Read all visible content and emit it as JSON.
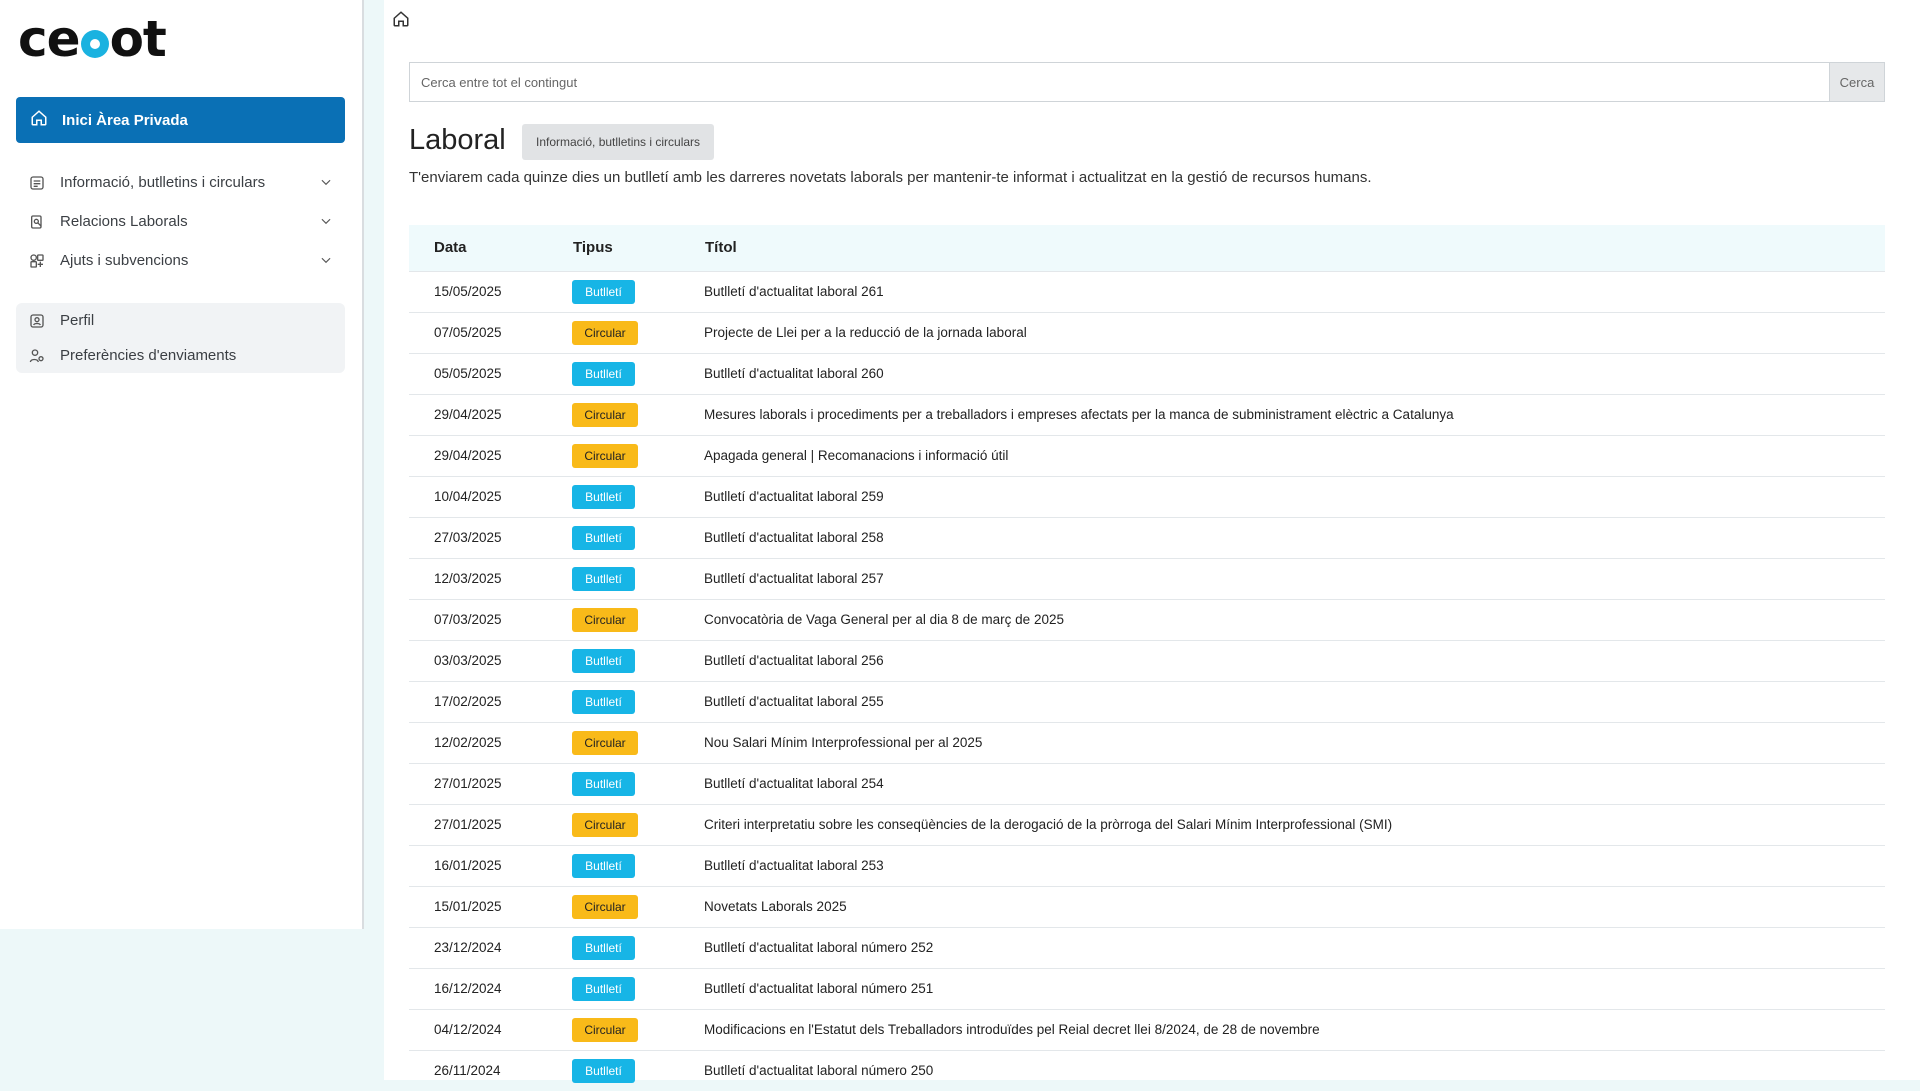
{
  "sidebar": {
    "logo": {
      "pre": "ce",
      "post": "ot"
    },
    "home_button": "Inici Àrea Privada",
    "nav_items": [
      {
        "label": "Informació, butlletins i circulars",
        "icon": "newsletter-icon"
      },
      {
        "label": "Relacions Laborals",
        "icon": "labor-icon"
      },
      {
        "label": "Ajuts i subvencions",
        "icon": "grants-icon"
      }
    ],
    "profile_items": [
      {
        "label": "Perfil",
        "icon": "profile-icon"
      },
      {
        "label": "Preferències d'enviaments",
        "icon": "user-settings-icon"
      }
    ]
  },
  "search": {
    "placeholder": "Cerca entre tot el contingut",
    "button": "Cerca"
  },
  "page": {
    "title": "Laboral",
    "tag": "Informació, butlletins i circulars",
    "description": "T'enviarem cada quinze dies un butlletí amb les darreres novetats laborals per mantenir-te informat i actualitzat en la gestió de recursos humans."
  },
  "table": {
    "headers": [
      "Data",
      "Tipus",
      "Títol"
    ],
    "rows": [
      {
        "date": "15/05/2025",
        "type": "Butlletí",
        "title": "Butlletí d'actualitat laboral 261"
      },
      {
        "date": "07/05/2025",
        "type": "Circular",
        "title": "Projecte de Llei per a la reducció de la jornada laboral"
      },
      {
        "date": "05/05/2025",
        "type": "Butlletí",
        "title": "Butlletí d'actualitat laboral 260"
      },
      {
        "date": "29/04/2025",
        "type": "Circular",
        "title": "Mesures laborals i procediments per a treballadors i empreses afectats per la manca de subministrament elèctric a Catalunya"
      },
      {
        "date": "29/04/2025",
        "type": "Circular",
        "title": "Apagada general | Recomanacions i informació útil"
      },
      {
        "date": "10/04/2025",
        "type": "Butlletí",
        "title": "Butlletí d'actualitat laboral 259"
      },
      {
        "date": "27/03/2025",
        "type": "Butlletí",
        "title": "Butlletí d'actualitat laboral 258"
      },
      {
        "date": "12/03/2025",
        "type": "Butlletí",
        "title": "Butlletí d'actualitat laboral 257"
      },
      {
        "date": "07/03/2025",
        "type": "Circular",
        "title": "Convocatòria de Vaga General per al dia 8 de març de 2025"
      },
      {
        "date": "03/03/2025",
        "type": "Butlletí",
        "title": "Butlletí d'actualitat laboral 256"
      },
      {
        "date": "17/02/2025",
        "type": "Butlletí",
        "title": "Butlletí d'actualitat laboral 255"
      },
      {
        "date": "12/02/2025",
        "type": "Circular",
        "title": "Nou Salari Mínim Interprofessional per al 2025"
      },
      {
        "date": "27/01/2025",
        "type": "Butlletí",
        "title": "Butlletí d'actualitat laboral 254"
      },
      {
        "date": "27/01/2025",
        "type": "Circular",
        "title": "Criteri interpretatiu sobre les conseqüències de la derogació de la pròrroga del Salari Mínim Interprofessional (SMI)"
      },
      {
        "date": "16/01/2025",
        "type": "Butlletí",
        "title": "Butlletí d'actualitat laboral 253"
      },
      {
        "date": "15/01/2025",
        "type": "Circular",
        "title": "Novetats Laborals 2025"
      },
      {
        "date": "23/12/2024",
        "type": "Butlletí",
        "title": "Butlletí d'actualitat laboral número 252"
      },
      {
        "date": "16/12/2024",
        "type": "Butlletí",
        "title": "Butlletí d'actualitat laboral número 251"
      },
      {
        "date": "04/12/2024",
        "type": "Circular",
        "title": "Modificacions en l'Estatut dels Treballadors introduïdes pel Reial decret llei 8/2024, de 28 de novembre"
      },
      {
        "date": "26/11/2024",
        "type": "Butlletí",
        "title": "Butlletí d'actualitat laboral número 250"
      }
    ]
  },
  "colors": {
    "primary": "#0a70b5",
    "butlleti": "#17b5e6",
    "circular": "#f9ba19",
    "logo_accent": "#1ab2e0"
  }
}
